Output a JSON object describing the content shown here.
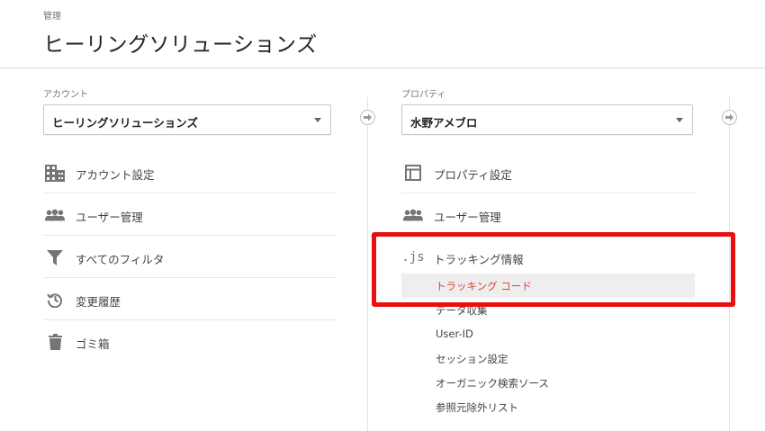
{
  "header": {
    "breadcrumb": "管理",
    "title": "ヒーリングソリューションズ"
  },
  "account": {
    "label": "アカウント",
    "selected": "ヒーリングソリューションズ",
    "items": [
      {
        "icon": "building-icon",
        "label": "アカウント設定"
      },
      {
        "icon": "users-icon",
        "label": "ユーザー管理"
      },
      {
        "icon": "filter-icon",
        "label": "すべてのフィルタ"
      },
      {
        "icon": "history-icon",
        "label": "変更履歴"
      },
      {
        "icon": "trash-icon",
        "label": "ゴミ箱"
      }
    ]
  },
  "property": {
    "label": "プロパティ",
    "selected": "水野アメブロ",
    "items": [
      {
        "icon": "window-icon",
        "label": "プロパティ設定"
      },
      {
        "icon": "users-icon",
        "label": "ユーザー管理"
      },
      {
        "icon": "js-icon",
        "icon_text": ".js",
        "label": "トラッキング情報"
      }
    ],
    "tracking_sub": [
      {
        "label": "トラッキング コード",
        "active": true
      },
      {
        "label": "データ収集"
      },
      {
        "label": "User-ID"
      },
      {
        "label": "セッション設定"
      },
      {
        "label": "オーガニック検索ソース"
      },
      {
        "label": "参照元除外リスト"
      }
    ]
  },
  "colors": {
    "highlight": "#e80f0f",
    "active_text": "#db4437",
    "icon": "#757575"
  }
}
